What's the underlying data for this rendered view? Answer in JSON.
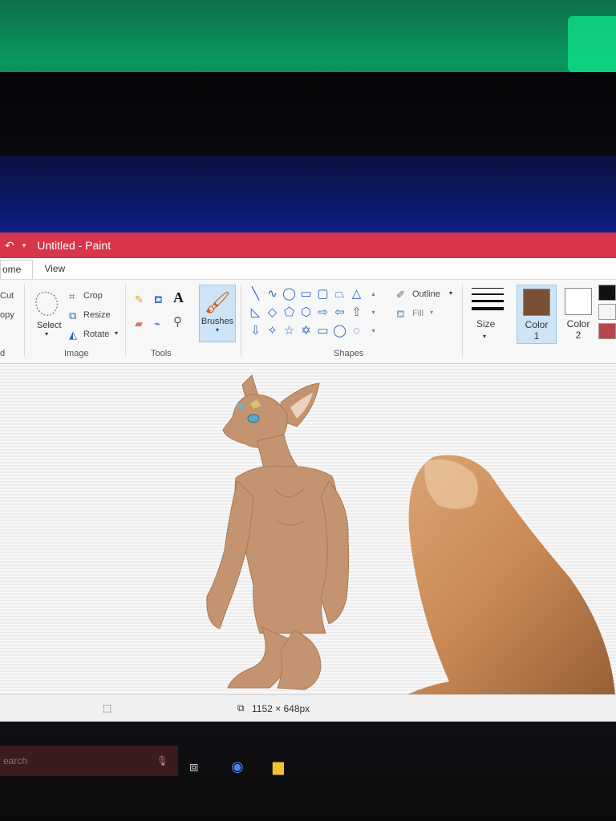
{
  "window": {
    "title": "Untitled - Paint",
    "accent_color": "#d8344a"
  },
  "tabs": [
    {
      "label": "ome"
    },
    {
      "label": "View"
    }
  ],
  "clipboard": {
    "cut": "Cut",
    "copy": "opy",
    "group": "d"
  },
  "select": {
    "label": "Select"
  },
  "image_group": {
    "crop": "Crop",
    "resize": "Resize",
    "rotate": "Rotate",
    "label": "Image"
  },
  "tools_group": {
    "label": "Tools",
    "text_tool": "A"
  },
  "brushes": {
    "label": "Brushes"
  },
  "shapes_group": {
    "label": "Shapes",
    "outline": "Outline",
    "fill": "Fill"
  },
  "size": {
    "label": "Size"
  },
  "color1": {
    "label": "Color",
    "num": "1",
    "value": "#7a5034"
  },
  "color2": {
    "label": "Color",
    "num": "2",
    "value": "#ffffff"
  },
  "palette": [
    "#111111",
    "#f4f4f4",
    "#b5474d"
  ],
  "status": {
    "dimensions": "1152 × 648px"
  },
  "taskbar": {
    "search_placeholder": "earch"
  }
}
